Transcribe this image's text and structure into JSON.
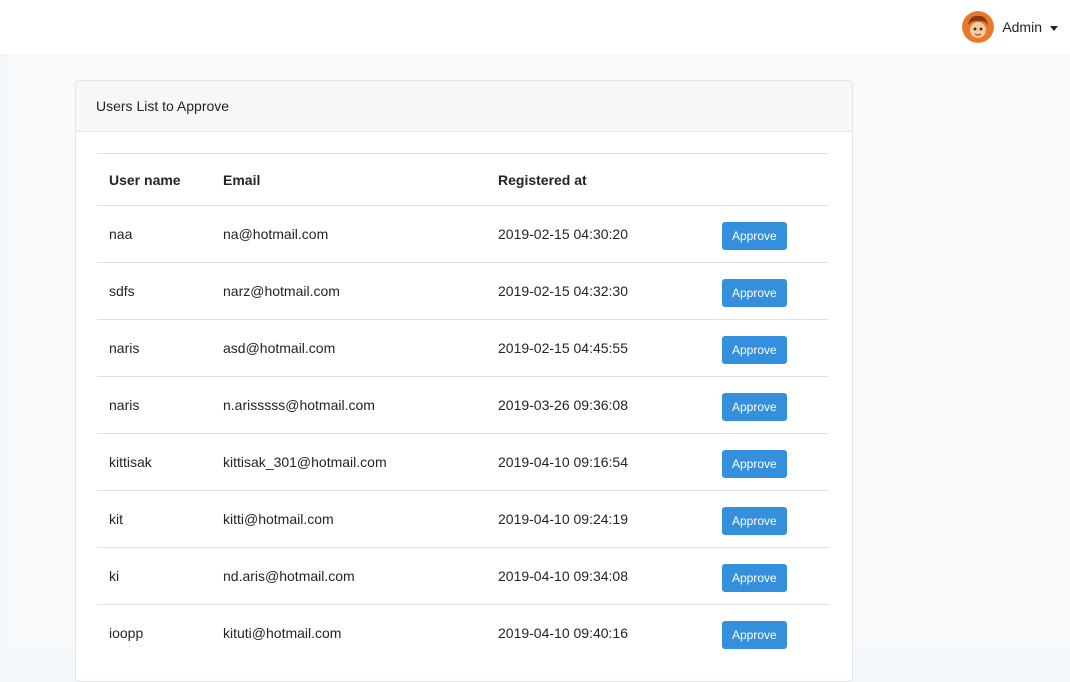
{
  "navbar": {
    "user_name": "Admin",
    "avatar_icon": "user-avatar-icon",
    "dropdown_icon": "caret-down-icon"
  },
  "card": {
    "title": "Users List to Approve"
  },
  "table": {
    "headers": {
      "username": "User name",
      "email": "Email",
      "registered": "Registered at"
    },
    "action_label": "Approve",
    "rows": [
      {
        "username": "naa",
        "email": "na@hotmail.com",
        "registered": "2019-02-15 04:30:20"
      },
      {
        "username": "sdfs",
        "email": "narz@hotmail.com",
        "registered": "2019-02-15 04:32:30"
      },
      {
        "username": "naris",
        "email": "asd@hotmail.com",
        "registered": "2019-02-15 04:45:55"
      },
      {
        "username": "naris",
        "email": "n.arisssss@hotmail.com",
        "registered": "2019-03-26 09:36:08"
      },
      {
        "username": "kittisak",
        "email": "kittisak_301@hotmail.com",
        "registered": "2019-04-10 09:16:54"
      },
      {
        "username": "kit",
        "email": "kitti@hotmail.com",
        "registered": "2019-04-10 09:24:19"
      },
      {
        "username": "ki",
        "email": "nd.aris@hotmail.com",
        "registered": "2019-04-10 09:34:08"
      },
      {
        "username": "ioopp",
        "email": "kituti@hotmail.com",
        "registered": "2019-04-10 09:40:16"
      }
    ]
  },
  "colors": {
    "primary": "#3490dc",
    "border": "#dee2e6",
    "background": "#f8fafc"
  }
}
